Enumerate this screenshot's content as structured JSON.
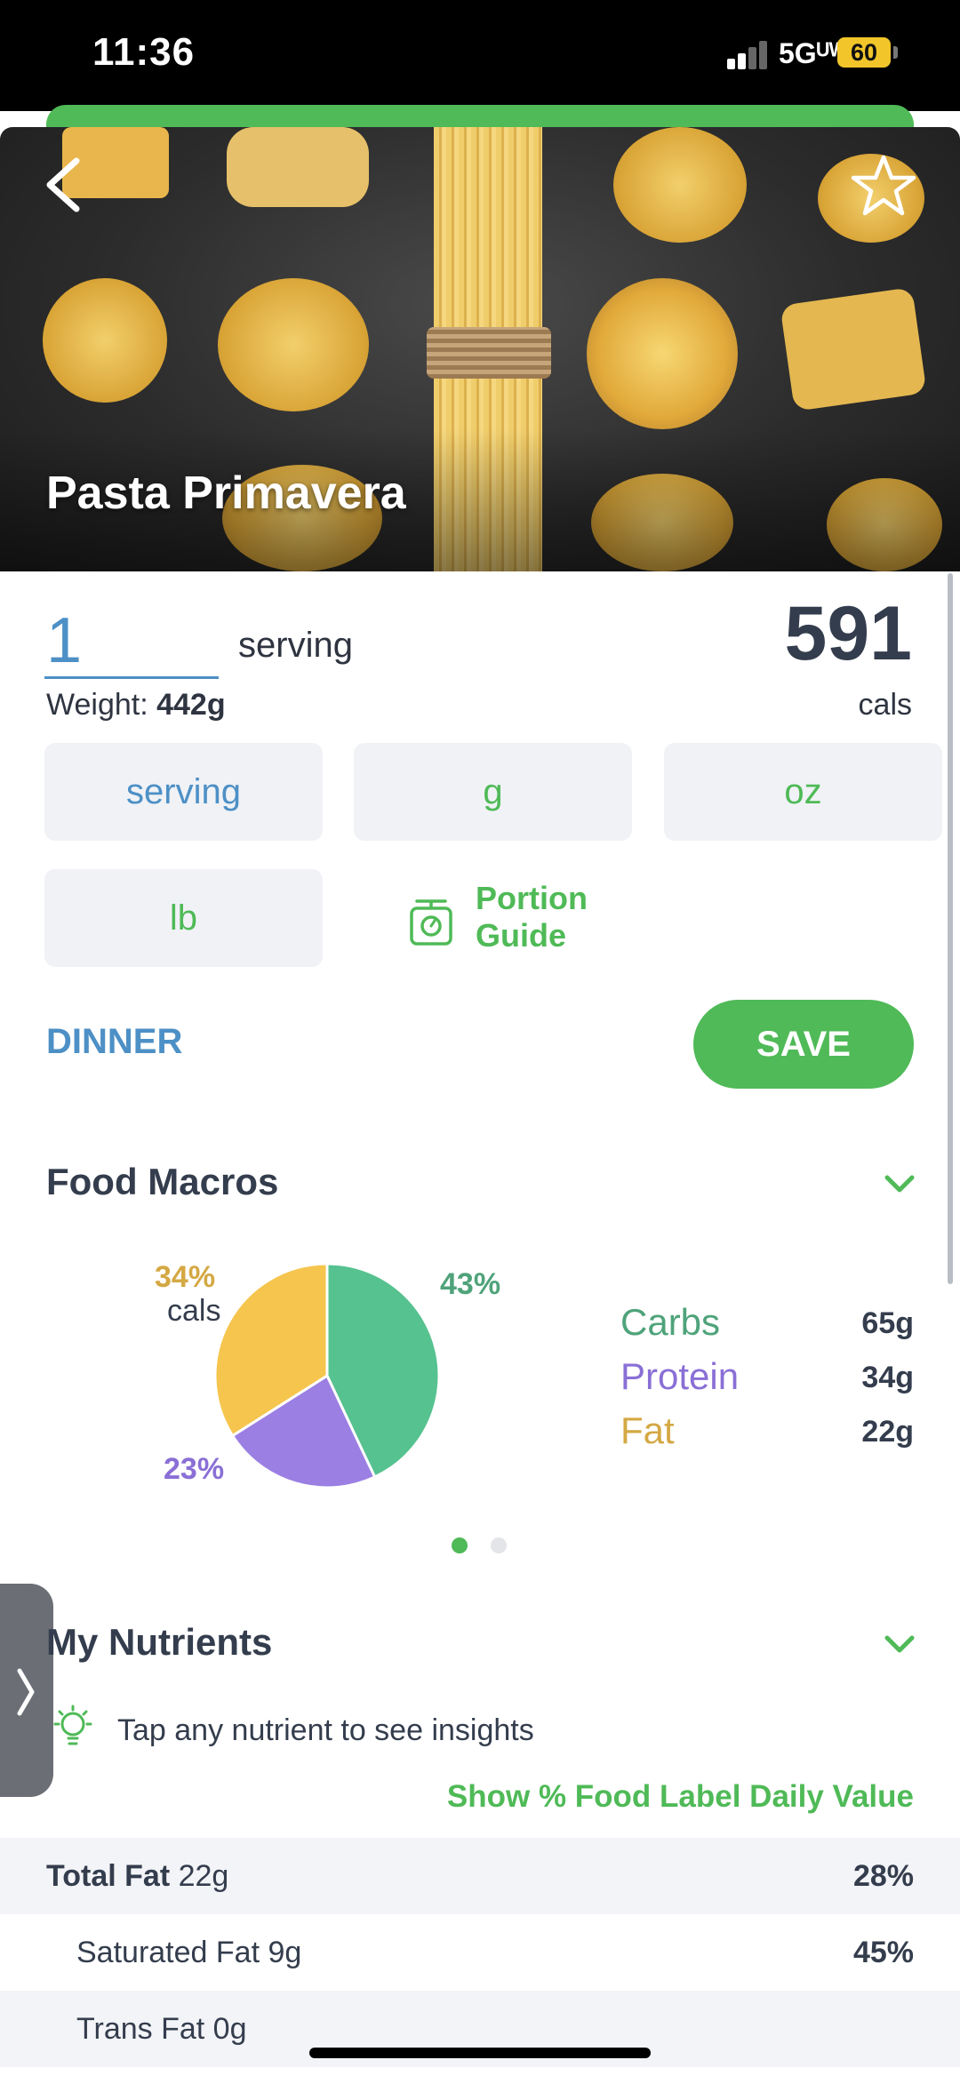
{
  "status_bar": {
    "time": "11:36",
    "network": "5Gᵁᵂ",
    "battery": "60"
  },
  "header": {
    "title": "Pasta Primavera",
    "back_icon": "chevron-left-icon",
    "favorite_icon": "star-outline-icon"
  },
  "serving": {
    "quantity": "1",
    "unit": "serving",
    "weight_label": "Weight:",
    "weight_value": "442g",
    "calories": "591",
    "calories_unit": "cals"
  },
  "unit_options": [
    "serving",
    "g",
    "oz",
    "lb"
  ],
  "selected_unit": "serving",
  "portion_guide": {
    "line1": "Portion",
    "line2": "Guide",
    "icon": "scale-icon"
  },
  "meal": "DINNER",
  "save_label": "SAVE",
  "food_macros": {
    "title": "Food Macros",
    "cals_word": "cals",
    "legend": [
      {
        "name": "Carbs",
        "value": "65g",
        "color": "#4fba57"
      },
      {
        "name": "Protein",
        "value": "34g",
        "color": "#9b7fe3"
      },
      {
        "name": "Fat",
        "value": "22g",
        "color": "#d4a843"
      }
    ],
    "page_indicator": {
      "count": 2,
      "active": 0
    }
  },
  "chart_data": {
    "type": "pie",
    "slices": [
      {
        "name": "Carbs",
        "percent": 43,
        "label": "43%",
        "color": "#56c28f"
      },
      {
        "name": "Protein",
        "percent": 23,
        "label": "23%",
        "color": "#9b7fe3"
      },
      {
        "name": "Fat",
        "percent": 34,
        "label": "34%",
        "color": "#f5c54e"
      }
    ]
  },
  "my_nutrients": {
    "title": "My Nutrients",
    "tip": "Tap any nutrient to see insights",
    "daily_value_link": "Show % Food Label Daily Value",
    "rows": [
      {
        "name": "Total Fat",
        "amount": "22g",
        "percent": "28%"
      },
      {
        "name": "Saturated Fat",
        "amount": "9g",
        "percent": "45%"
      },
      {
        "name": "Trans Fat",
        "amount": "0g",
        "percent": ""
      }
    ]
  }
}
